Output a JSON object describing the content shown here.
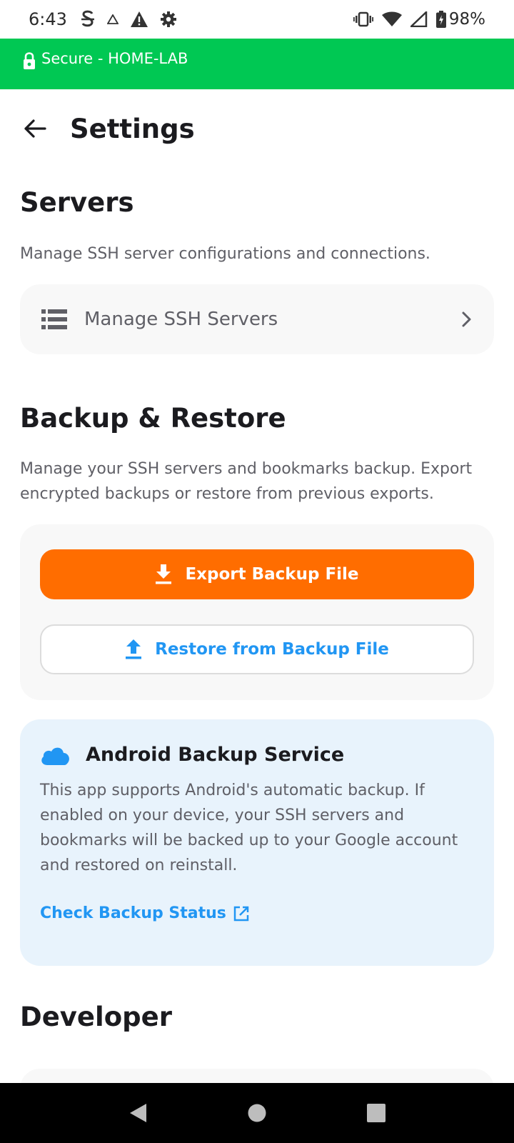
{
  "status_bar": {
    "time": "6:43",
    "battery": "98%"
  },
  "banner": {
    "text": "Secure - HOME-LAB",
    "color": "#00c853"
  },
  "app_bar": {
    "title": "Settings"
  },
  "servers": {
    "title": "Servers",
    "description": "Manage SSH server configurations and connections.",
    "item_label": "Manage SSH Servers"
  },
  "backup": {
    "title": "Backup & Restore",
    "description": "Manage your SSH servers and bookmarks backup. Export encrypted backups or restore from previous exports.",
    "export_label": "Export Backup File",
    "restore_label": "Restore from Backup File",
    "export_color": "#ff6d00",
    "accent_color": "#2196f3"
  },
  "android_backup": {
    "title": "Android Backup Service",
    "body": "This app supports Android's automatic backup. If enabled on your device, your SSH servers and bookmarks will be backed up to your Google account and restored on reinstall.",
    "link_label": "Check Backup Status"
  },
  "developer": {
    "title": "Developer"
  }
}
